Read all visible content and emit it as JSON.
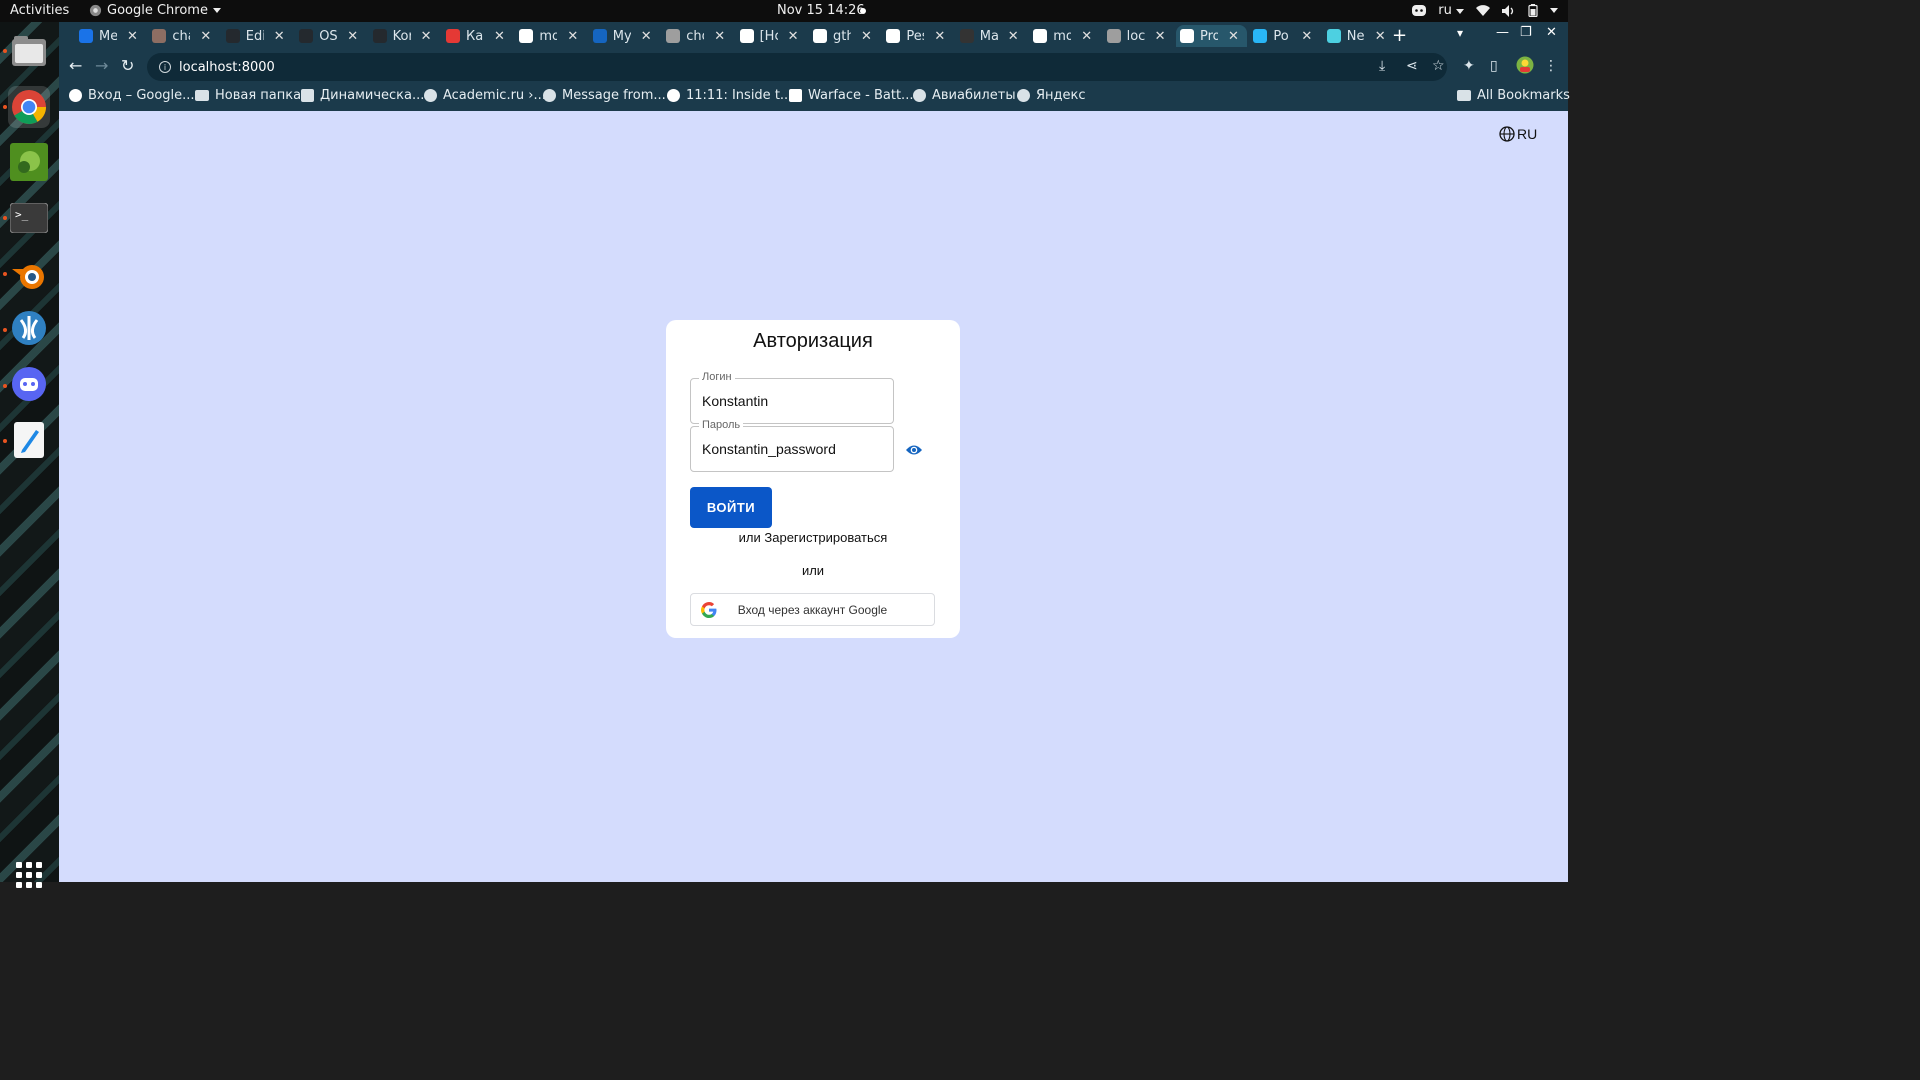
{
  "topbar": {
    "activities": "Activities",
    "app_name": "Google Chrome",
    "clock": "Nov 15  14:26",
    "keyboard_layout": "ru"
  },
  "dock": {
    "items": [
      "files-icon",
      "chrome-icon",
      "image-viewer-icon",
      "terminal-icon",
      "blender-icon",
      "vscodium-icon",
      "discord-icon",
      "text-editor-icon"
    ]
  },
  "browser": {
    "tabs": [
      {
        "title": "Me",
        "favicon_color": "#1a73e8"
      },
      {
        "title": "cha",
        "favicon_color": "#8d6e63"
      },
      {
        "title": "Edi",
        "favicon_color": "#24292e"
      },
      {
        "title": "OSI",
        "favicon_color": "#24292e"
      },
      {
        "title": "Kor",
        "favicon_color": "#24292e"
      },
      {
        "title": "Как",
        "favicon_color": "#e53935"
      },
      {
        "title": "mo",
        "favicon_color": "#ffffff"
      },
      {
        "title": "My",
        "favicon_color": "#1565c0"
      },
      {
        "title": "cho",
        "favicon_color": "#9e9e9e"
      },
      {
        "title": "[Hc",
        "favicon_color": "#ffffff"
      },
      {
        "title": "gth",
        "favicon_color": "#ffffff"
      },
      {
        "title": "Pes",
        "favicon_color": "#ffffff"
      },
      {
        "title": "Ma",
        "favicon_color": "#333333"
      },
      {
        "title": "mo",
        "favicon_color": "#ffffff"
      },
      {
        "title": "loc",
        "favicon_color": "#9e9e9e"
      },
      {
        "title": "Pro",
        "favicon_color": "#ffffff"
      },
      {
        "title": "Po",
        "favicon_color": "#29b6f6"
      },
      {
        "title": "Ne",
        "favicon_color": "#4dd0e1"
      }
    ],
    "url": "localhost:8000",
    "bookmarks": [
      "Вход – Google...",
      "Новая папка",
      "Динамическа...",
      "Academic.ru ›...",
      "Message from...",
      "11:11: Inside t...",
      "Warface - Batt...",
      "Авиабилеты",
      "Яндекс"
    ],
    "all_bookmarks": "All Bookmarks"
  },
  "page": {
    "language": "RU",
    "title": "Авторизация",
    "login": {
      "label": "Логин",
      "value": "Konstantin"
    },
    "password": {
      "label": "Пароль",
      "value": "Konstantin_password"
    },
    "submit_label": "ВОЙТИ",
    "register_text": "или Зарегистрироваться",
    "or_text": "или",
    "google_label": "Вход через аккаунт Google",
    "accent_color": "#0b57c8",
    "background_color": "#d4dcfd"
  }
}
